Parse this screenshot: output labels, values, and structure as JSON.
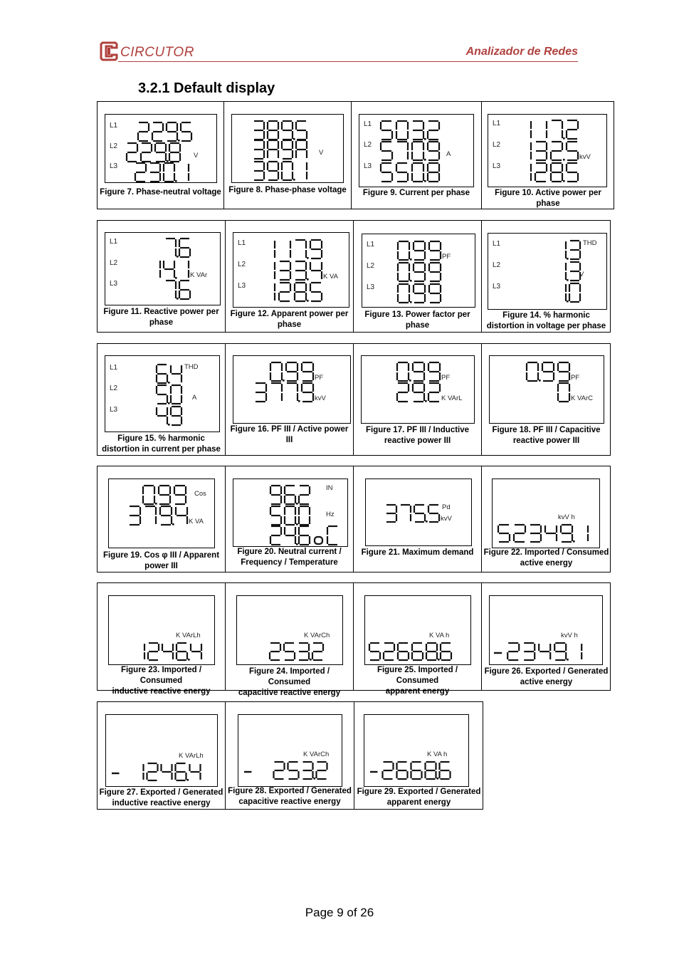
{
  "header": {
    "brand": "CIRCUTOR",
    "doc_title": "Analizador de Redes",
    "brand_color": "#b0413e"
  },
  "section": {
    "number": "3.2.1",
    "title": "3.2.1  Default display"
  },
  "footer": {
    "page_label": "Page 9 of 26"
  },
  "figures": [
    {
      "id": 7,
      "caption": [
        "Figure 7. Phase-neutral voltage"
      ],
      "lines": [
        {
          "label": "L1",
          "value": "229.5"
        },
        {
          "label": "L2",
          "value": "229.8"
        },
        {
          "label": "L3",
          "value": "230.1"
        }
      ],
      "units": [
        {
          "text": "V",
          "row": 1
        }
      ]
    },
    {
      "id": 8,
      "caption": [
        "Figure 8. Phase-phase voltage"
      ],
      "lines": [
        {
          "label": "",
          "value": "389.5"
        },
        {
          "label": "",
          "value": "3A9A"
        },
        {
          "label": "",
          "value": "390.1"
        }
      ],
      "units": [
        {
          "text": "V",
          "row": 1
        }
      ]
    },
    {
      "id": 9,
      "caption": [
        "Figure 9.  Current per phase"
      ],
      "lines": [
        {
          "label": "L1",
          "value": "503.2"
        },
        {
          "label": "L2",
          "value": "570.9"
        },
        {
          "label": "L3",
          "value": "550.8"
        }
      ],
      "units": [
        {
          "text": "A",
          "row": 1
        }
      ]
    },
    {
      "id": 10,
      "caption": [
        "Figure 10. Active power per",
        "phase"
      ],
      "lines": [
        {
          "label": "L1",
          "value": "117.2"
        },
        {
          "label": "L2",
          "value": "132.5"
        },
        {
          "label": "L3",
          "value": "128.5"
        }
      ],
      "units": [
        {
          "text": "kvV",
          "row": 1
        }
      ]
    },
    {
      "id": 11,
      "caption": [
        "Figure 11. Reactive power per",
        "phase"
      ],
      "lines": [
        {
          "label": "L1",
          "value": "7.6"
        },
        {
          "label": "L2",
          "value": "14.1"
        },
        {
          "label": "L3",
          "value": "7.6"
        }
      ],
      "units": [
        {
          "text": "K VAr",
          "row": 1
        }
      ]
    },
    {
      "id": 12,
      "caption": [
        "Figure 12. Apparent power per",
        "phase"
      ],
      "lines": [
        {
          "label": "L1",
          "value": "117.9"
        },
        {
          "label": "L2",
          "value": "133.4"
        },
        {
          "label": "L3",
          "value": "128.5"
        }
      ],
      "units": [
        {
          "text": "K VA",
          "row": 1
        }
      ]
    },
    {
      "id": 13,
      "caption": [
        "Figure 13. Power factor per",
        "phase"
      ],
      "lines": [
        {
          "label": "L1",
          "value": "0.99"
        },
        {
          "label": "L2",
          "value": "0.99"
        },
        {
          "label": "L3",
          "value": "0.99"
        }
      ],
      "units": [
        {
          "text": "PF",
          "row": 0
        }
      ]
    },
    {
      "id": 14,
      "caption": [
        "Figure 14. % harmonic",
        "distortion in voltage per phase"
      ],
      "lines": [
        {
          "label": "L1",
          "value": "1.3"
        },
        {
          "label": "L2",
          "value": "1.3"
        },
        {
          "label": "L3",
          "value": "1.0"
        }
      ],
      "units": [
        {
          "text": "THD",
          "row": 0,
          "top": true
        },
        {
          "text": "V",
          "row": 1
        }
      ]
    },
    {
      "id": 15,
      "caption": [
        "Figure 15. % harmonic",
        "distortion in current per phase"
      ],
      "lines": [
        {
          "label": "L1",
          "value": "6.4"
        },
        {
          "label": "L2",
          "value": "5.0"
        },
        {
          "label": "L3",
          "value": "4.9"
        }
      ],
      "units": [
        {
          "text": "THD",
          "row": 0,
          "top": true
        },
        {
          "text": "A",
          "row": 1
        }
      ]
    },
    {
      "id": 16,
      "caption": [
        "Figure 16. PF III / Active power",
        "III"
      ],
      "lines": [
        {
          "label": "",
          "value": "0.99"
        },
        {
          "label": "",
          "value": "377.9"
        }
      ],
      "units": [
        {
          "text": "PF",
          "row": 0
        },
        {
          "text": "kvV",
          "row": 1
        }
      ]
    },
    {
      "id": 17,
      "caption": [
        "Figure 17. PF III / Inductive",
        "reactive power III"
      ],
      "lines": [
        {
          "label": "",
          "value": "0.99"
        },
        {
          "label": "",
          "value": "29.2"
        }
      ],
      "units": [
        {
          "text": "PF",
          "row": 0
        },
        {
          "text": "K VArL",
          "row": 1
        }
      ]
    },
    {
      "id": 18,
      "caption": [
        "Figure 18. PF III / Capacitive",
        "reactive power III"
      ],
      "lines": [
        {
          "label": "",
          "value": "0.99"
        },
        {
          "label": "",
          "value": "0"
        }
      ],
      "units": [
        {
          "text": "PF",
          "row": 0
        },
        {
          "text": "K VArC",
          "row": 1
        }
      ]
    },
    {
      "id": 19,
      "caption": [
        "Figure 19. Cos φ III / Apparent",
        "power III"
      ],
      "lines": [
        {
          "label": "",
          "value": "0.99"
        },
        {
          "label": "",
          "value": "379.4"
        }
      ],
      "units": [
        {
          "text": "Cos",
          "row": 0,
          "mid": true
        },
        {
          "text": "K VA",
          "row": 1
        }
      ]
    },
    {
      "id": 20,
      "caption": [
        "Figure 20. Neutral current /",
        "Frequency / Temperature"
      ],
      "lines": [
        {
          "label": "",
          "value": "96.2"
        },
        {
          "label": "",
          "value": "50.0"
        },
        {
          "label": "",
          "value": "24.6oC"
        }
      ],
      "units": [
        {
          "text": "IN",
          "row": 0,
          "top": true
        },
        {
          "text": "Hz",
          "row": 1,
          "top": true
        }
      ]
    },
    {
      "id": 21,
      "caption": [
        "Figure 21. Maximum demand"
      ],
      "lines": [
        {
          "label": "",
          "value": "375.5"
        }
      ],
      "units": [
        {
          "text": "Pd",
          "row": 0,
          "top": true
        },
        {
          "text": "kvV",
          "row": 0
        }
      ]
    },
    {
      "id": 22,
      "caption": [
        "Figure 22. Imported / Consumed",
        "active energy"
      ],
      "lines": [
        {
          "label": "",
          "value": "52349.1"
        }
      ],
      "units": [
        {
          "text": "kvV    h",
          "row": 0,
          "above": true
        }
      ]
    },
    {
      "id": 23,
      "caption": [
        "Figure 23. Imported / Consumed",
        "inductive reactive energy"
      ],
      "lines": [
        {
          "label": "",
          "value": "1246.4"
        }
      ],
      "units": [
        {
          "text": "K VArLh",
          "row": 0,
          "above": true
        }
      ]
    },
    {
      "id": 24,
      "caption": [
        "Figure 24. Imported / Consumed",
        "capacitive reactive energy"
      ],
      "lines": [
        {
          "label": "",
          "value": "253.2"
        }
      ],
      "units": [
        {
          "text": "K VArCh",
          "row": 0,
          "above": true
        }
      ]
    },
    {
      "id": 25,
      "caption": [
        "Figure 25. Imported / Consumed",
        "apparent energy"
      ],
      "lines": [
        {
          "label": "",
          "value": "52668.6"
        }
      ],
      "units": [
        {
          "text": "K VA   h",
          "row": 0,
          "above": true
        }
      ]
    },
    {
      "id": 26,
      "caption": [
        "Figure 26. Exported / Generated",
        "active energy"
      ],
      "lines": [
        {
          "label": "",
          "value": "-2349.1"
        }
      ],
      "units": [
        {
          "text": "kvV    h",
          "row": 0,
          "above": true
        }
      ]
    },
    {
      "id": 27,
      "caption": [
        "Figure 27. Exported / Generated",
        "inductive reactive energy"
      ],
      "lines": [
        {
          "label": "",
          "value": "- 1246.4"
        }
      ],
      "units": [
        {
          "text": "K VArLh",
          "row": 0,
          "above": true
        }
      ]
    },
    {
      "id": 28,
      "caption": [
        "Figure 28. Exported / Generated",
        "capacitive reactive energy"
      ],
      "lines": [
        {
          "label": "",
          "value": "-  253.2"
        }
      ],
      "units": [
        {
          "text": "K VArCh",
          "row": 0,
          "above": true
        }
      ]
    },
    {
      "id": 29,
      "caption": [
        "Figure 29. Exported / Generated",
        "apparent energy"
      ],
      "lines": [
        {
          "label": "",
          "value": "-2668.6"
        }
      ],
      "units": [
        {
          "text": "K VA   h",
          "row": 0,
          "above": true
        }
      ]
    }
  ]
}
